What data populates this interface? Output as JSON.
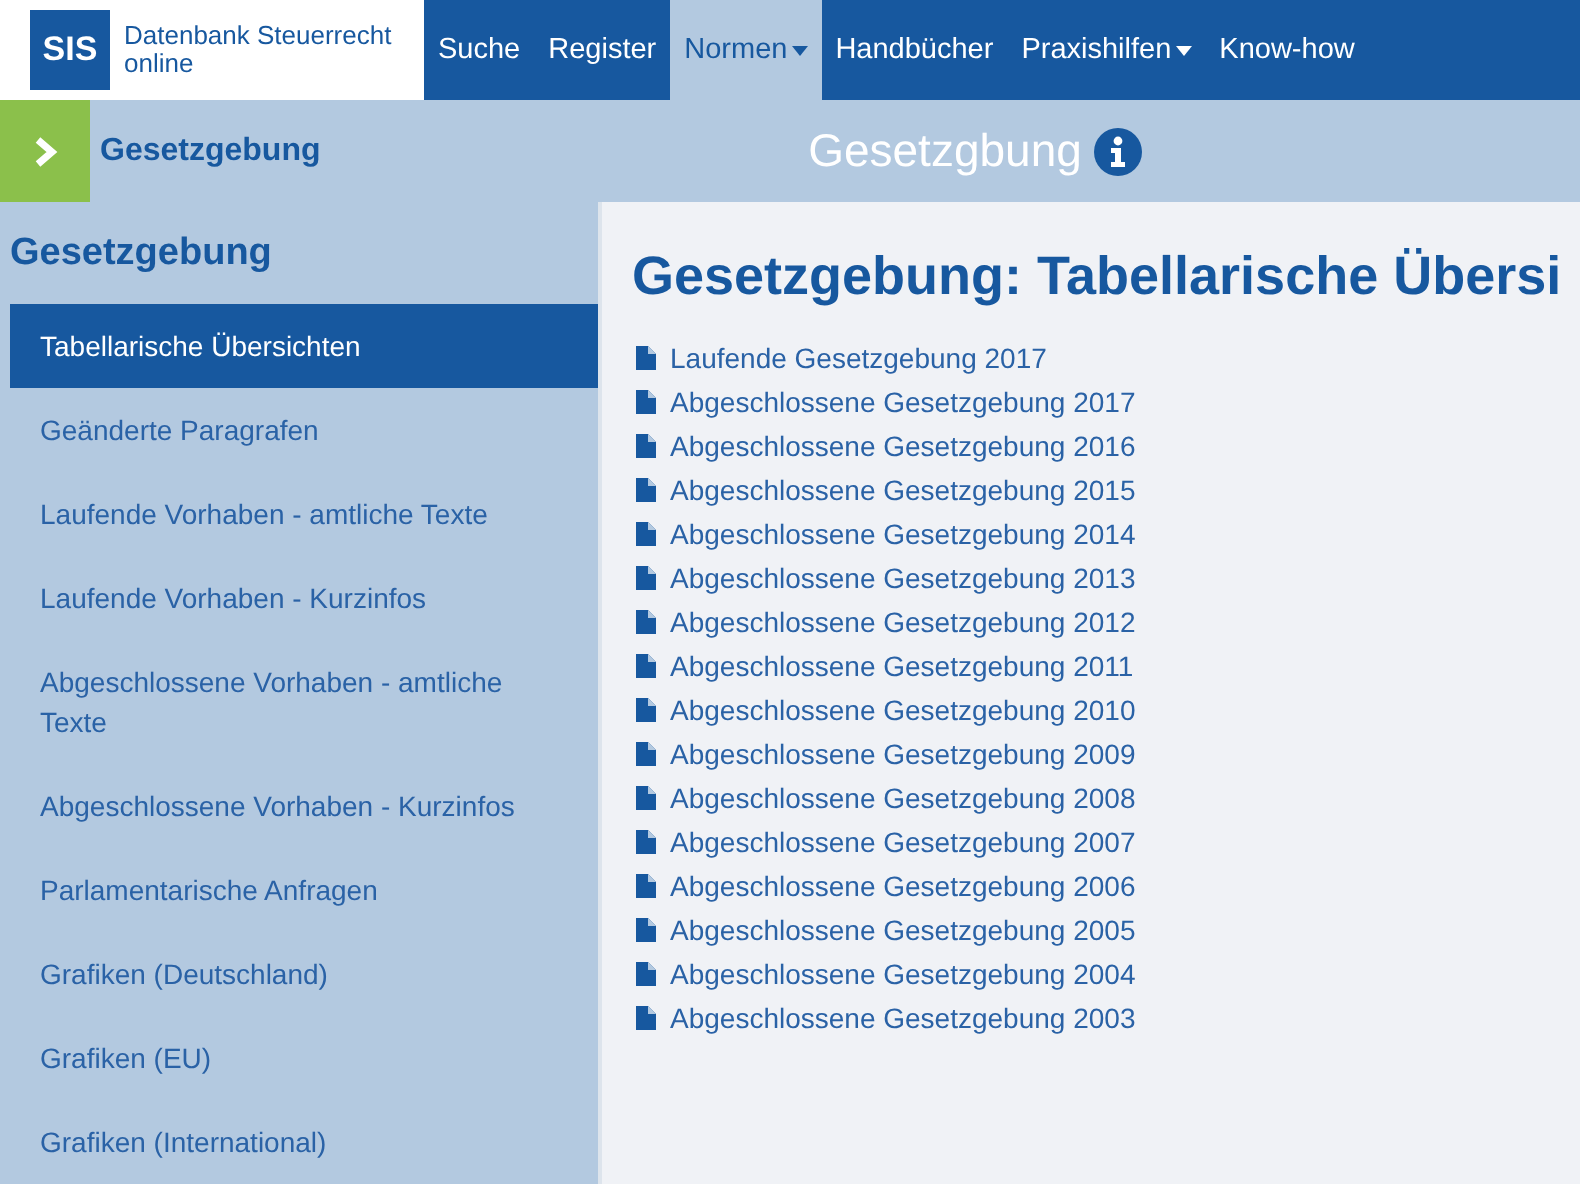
{
  "logo": {
    "mark": "SIS",
    "name": "Datenbank Steuerrecht online"
  },
  "nav": [
    {
      "label": "Suche",
      "selected": false,
      "dropdown": false
    },
    {
      "label": "Register",
      "selected": false,
      "dropdown": false
    },
    {
      "label": "Normen",
      "selected": true,
      "dropdown": true
    },
    {
      "label": "Handbücher",
      "selected": false,
      "dropdown": false
    },
    {
      "label": "Praxishilfen",
      "selected": false,
      "dropdown": true
    },
    {
      "label": "Know-how",
      "selected": false,
      "dropdown": false
    }
  ],
  "subbar": {
    "section": "Gesetzgebung",
    "title": "Gesetzgbung"
  },
  "sidebar": {
    "heading": "Gesetzgebung",
    "items": [
      {
        "label": "Tabellarische Übersichten",
        "selected": true
      },
      {
        "label": "Geänderte Paragrafen",
        "selected": false
      },
      {
        "label": "Laufende Vorhaben - amtliche Texte",
        "selected": false
      },
      {
        "label": "Laufende Vorhaben - Kurzinfos",
        "selected": false
      },
      {
        "label": "Abgeschlossene Vorhaben - amtliche Texte",
        "selected": false
      },
      {
        "label": "Abgeschlossene Vorhaben - Kurzinfos",
        "selected": false
      },
      {
        "label": "Parlamentarische Anfragen",
        "selected": false
      },
      {
        "label": "Grafiken (Deutschland)",
        "selected": false
      },
      {
        "label": "Grafiken (EU)",
        "selected": false
      },
      {
        "label": "Grafiken (International)",
        "selected": false
      }
    ]
  },
  "content": {
    "heading": "Gesetzgebung: Tabellarische Übersi",
    "documents": [
      "Laufende Gesetzgebung 2017",
      "Abgeschlossene Gesetzgebung 2017",
      "Abgeschlossene Gesetzgebung 2016",
      "Abgeschlossene Gesetzgebung 2015",
      "Abgeschlossene Gesetzgebung 2014",
      "Abgeschlossene Gesetzgebung 2013",
      "Abgeschlossene Gesetzgebung 2012",
      "Abgeschlossene Gesetzgebung 2011",
      "Abgeschlossene Gesetzgebung 2010",
      "Abgeschlossene Gesetzgebung 2009",
      "Abgeschlossene Gesetzgebung 2008",
      "Abgeschlossene Gesetzgebung 2007",
      "Abgeschlossene Gesetzgebung 2006",
      "Abgeschlossene Gesetzgebung 2005",
      "Abgeschlossene Gesetzgebung 2004",
      "Abgeschlossene Gesetzgebung 2003"
    ]
  }
}
